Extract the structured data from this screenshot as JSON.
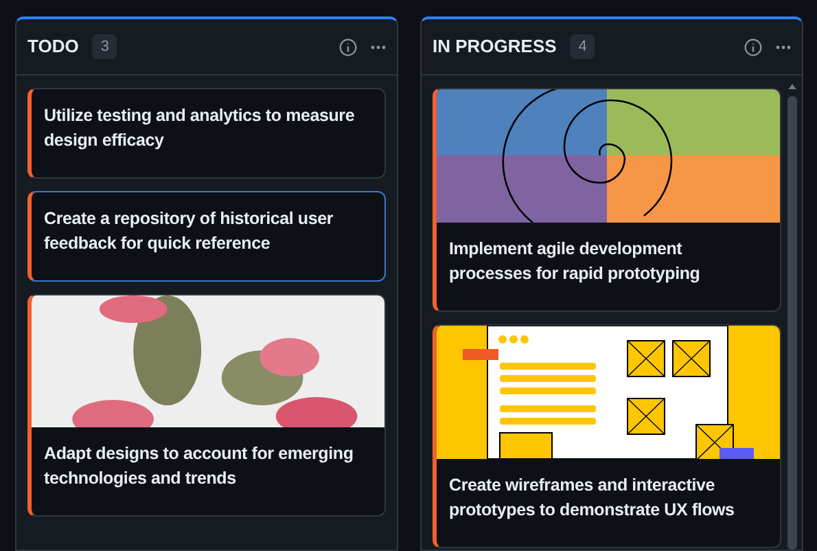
{
  "columns": [
    {
      "title": "TODO",
      "count": "3",
      "scrollbar": false,
      "cards": [
        {
          "kind": "plain",
          "title": "Utilize testing and analytics to measure design efficacy",
          "selected": false
        },
        {
          "kind": "plain",
          "title": "Create a repository of historical user feedback for quick reference",
          "selected": true
        },
        {
          "kind": "photo",
          "title": "Adapt designs to account for emerging technologies and trends",
          "selected": false
        }
      ]
    },
    {
      "title": "IN PROGRESS",
      "count": "4",
      "scrollbar": true,
      "cards": [
        {
          "kind": "spiral-diagram",
          "title": "Implement agile development processes for rapid prototyping",
          "selected": false
        },
        {
          "kind": "wireframe-illustration",
          "title": "Create wireframes and interactive prototypes to demonstrate UX flows",
          "selected": false
        }
      ]
    }
  ]
}
